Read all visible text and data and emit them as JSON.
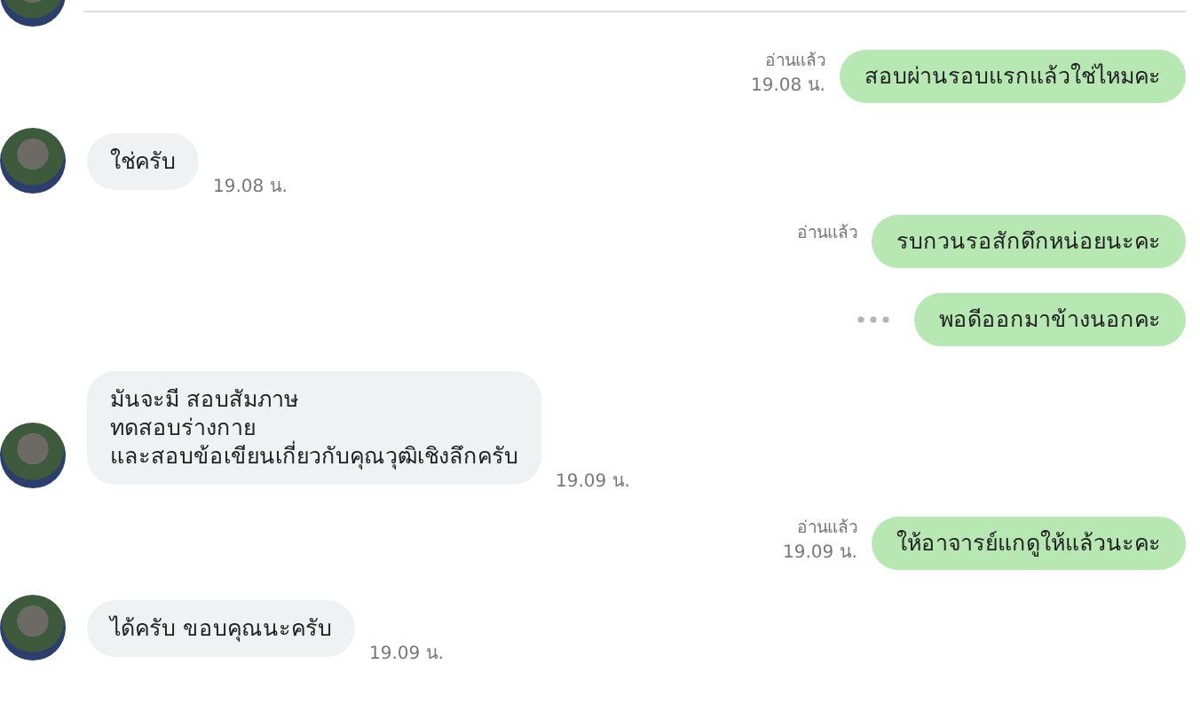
{
  "messages": [
    {
      "kind": "outgoing",
      "text": "สอบผ่านรอบแรกแล้วใช่ไหมคะ",
      "read_label": "อ่านแล้ว",
      "time": "19.08 น.",
      "more": false
    },
    {
      "kind": "incoming",
      "text": "ใช่ครับ",
      "time": "19.08 น."
    },
    {
      "kind": "outgoing",
      "text": "รบกวนรอสักดึกหน่อยนะคะ",
      "read_label": "อ่านแล้ว",
      "more": false
    },
    {
      "kind": "outgoing",
      "text": "พอดีออกมาข้างนอกคะ",
      "more": true
    },
    {
      "kind": "incoming",
      "text": "มันจะมี สอบสัมภาษ\nทดสอบร่างกาย\nและสอบข้อเขียนเกี่ยวกับคุณวุฒิเชิงลึกครับ",
      "time": "19.09 น."
    },
    {
      "kind": "outgoing",
      "text": "ให้อาจารย์แกดูให้แล้วนะคะ",
      "read_label": "อ่านแล้ว",
      "time": "19.09 น.",
      "more": false
    },
    {
      "kind": "incoming",
      "text": "ได้ครับ ขอบคุณนะครับ",
      "time": "19.09 น."
    }
  ]
}
